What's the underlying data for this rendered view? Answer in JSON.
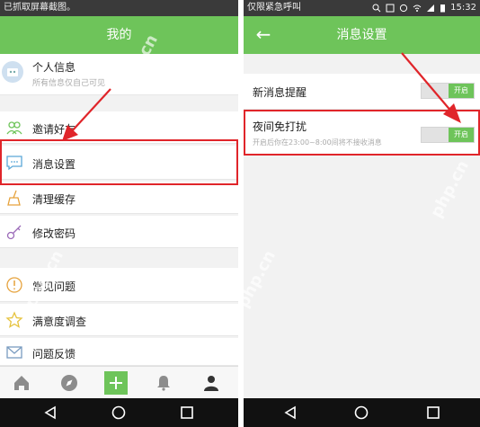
{
  "left": {
    "status_text": "已抓取屏幕截图。",
    "title": "我的",
    "profile": {
      "name": "个人信息",
      "subtitle": "所有信息仅自己可见"
    },
    "items": [
      {
        "label": "邀请好友",
        "icon": "people-icon"
      },
      {
        "label": "消息设置",
        "icon": "chat-bubble-icon"
      },
      {
        "label": "清理缓存",
        "icon": "broom-icon"
      },
      {
        "label": "修改密码",
        "icon": "key-icon"
      },
      {
        "label": "常见问题",
        "icon": "question-icon"
      },
      {
        "label": "满意度调查",
        "icon": "star-icon"
      },
      {
        "label": "问题反馈",
        "icon": "envelope-icon"
      }
    ],
    "bottom_nav": [
      "home-icon",
      "compass-icon",
      "plus-icon",
      "bell-icon",
      "person-icon"
    ]
  },
  "right": {
    "status_text": "仅限紧急呼叫",
    "time": "15:32",
    "title": "消息设置",
    "settings": [
      {
        "label": "新消息提醒",
        "toggle_label": "开启",
        "enabled": true
      },
      {
        "label": "夜间免打扰",
        "description": "开启后你在23:00~8:00间将不接收消息",
        "toggle_label": "开启",
        "enabled": true
      }
    ]
  },
  "watermark": "php.cn",
  "colors": {
    "header_green": "#6ec45a",
    "highlight_red": "#e0252a"
  }
}
